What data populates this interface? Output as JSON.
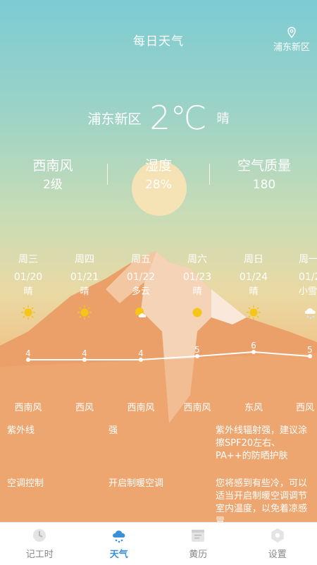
{
  "header": {
    "title": "每日天气",
    "location": "浦东新区"
  },
  "current": {
    "city": "浦东新区",
    "temp": "2℃",
    "condition": "晴"
  },
  "stats": [
    {
      "label": "西南风",
      "value": "2级"
    },
    {
      "label": "湿度",
      "value": "28%"
    },
    {
      "label": "空气质量",
      "value": "180"
    }
  ],
  "forecast": [
    {
      "weekday": "周三",
      "date": "01/20",
      "cond": "晴",
      "icon": "sun-icon",
      "temp": "4",
      "wind": "西南风"
    },
    {
      "weekday": "周四",
      "date": "01/21",
      "cond": "晴",
      "icon": "sun-icon",
      "temp": "4",
      "wind": "西风"
    },
    {
      "weekday": "周五",
      "date": "01/22",
      "cond": "多云",
      "icon": "partly-cloudy-icon",
      "temp": "4",
      "wind": "西南风"
    },
    {
      "weekday": "周六",
      "date": "01/23",
      "cond": "晴",
      "icon": "sun-icon",
      "temp": "5",
      "wind": "西南风"
    },
    {
      "weekday": "周日",
      "date": "01/24",
      "cond": "晴",
      "icon": "sun-icon",
      "temp": "6",
      "wind": "东风"
    },
    {
      "weekday": "周一",
      "date": "01/2",
      "cond": "小雪",
      "icon": "snow-icon",
      "temp": "5",
      "wind": "西风"
    }
  ],
  "tips": [
    {
      "name": "紫外线",
      "value": "强",
      "desc": "紫外线辐射强，建议涂擦SPF20左右、PA++的防晒护肤"
    },
    {
      "name": "空调控制",
      "value": "开启制暖空调",
      "desc": "您将感到有些冷，可以适当开启制暖空调调节室内温度，以免着凉感冒。"
    }
  ],
  "tabbar": [
    {
      "label": "记工时",
      "icon": "clock-icon",
      "active": false
    },
    {
      "label": "天气",
      "icon": "cloud-rain-icon",
      "active": true
    },
    {
      "label": "黄历",
      "icon": "calendar-icon",
      "active": false
    },
    {
      "label": "设置",
      "icon": "gear-icon",
      "active": false
    }
  ],
  "colors": {
    "accent": "#3a8fd6",
    "sun": "#f5c518"
  }
}
